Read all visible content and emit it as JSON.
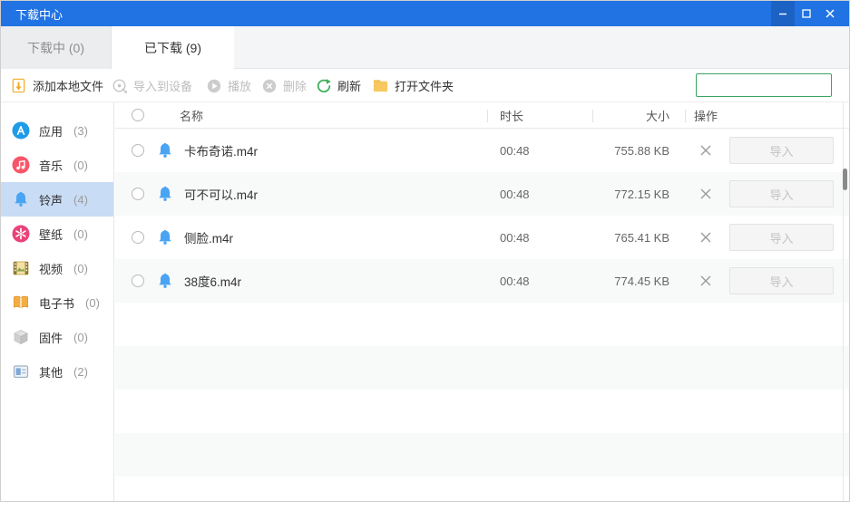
{
  "window": {
    "title": "下载中心"
  },
  "tabs": {
    "downloading": "下载中 (0)",
    "downloaded": "已下载 (9)"
  },
  "toolbar": {
    "add_local_file": "添加本地文件",
    "import_to_device": "导入到设备",
    "play": "播放",
    "delete": "删除",
    "refresh": "刷新",
    "open_folder": "打开文件夹",
    "search_value": ""
  },
  "sidebar": {
    "items": [
      {
        "label": "应用",
        "count": "(3)",
        "icon": "app-store-icon",
        "selected": false
      },
      {
        "label": "音乐",
        "count": "(0)",
        "icon": "music-icon",
        "selected": false
      },
      {
        "label": "铃声",
        "count": "(4)",
        "icon": "bell-icon",
        "selected": true
      },
      {
        "label": "壁纸",
        "count": "(0)",
        "icon": "wallpaper-icon",
        "selected": false
      },
      {
        "label": "视频",
        "count": "(0)",
        "icon": "video-icon",
        "selected": false
      },
      {
        "label": "电子书",
        "count": "(0)",
        "icon": "ebook-icon",
        "selected": false
      },
      {
        "label": "固件",
        "count": "(0)",
        "icon": "firmware-icon",
        "selected": false
      },
      {
        "label": "其他",
        "count": "(2)",
        "icon": "other-icon",
        "selected": false
      }
    ]
  },
  "table": {
    "headers": {
      "name": "名称",
      "duration": "时长",
      "size": "大小",
      "action": "操作"
    },
    "rows": [
      {
        "name": "卡布奇诺.m4r",
        "duration": "00:48",
        "size": "755.88 KB",
        "action": "导入"
      },
      {
        "name": "可不可以.m4r",
        "duration": "00:48",
        "size": "772.15 KB",
        "action": "导入"
      },
      {
        "name": "侧脸.m4r",
        "duration": "00:48",
        "size": "765.41 KB",
        "action": "导入"
      },
      {
        "name": "38度6.m4r",
        "duration": "00:48",
        "size": "774.45 KB",
        "action": "导入"
      }
    ]
  },
  "colors": {
    "titlebar_blue": "#2173e3",
    "selection_blue": "#c9dcf5",
    "bell_blue": "#49a4f3",
    "search_border_green": "#3aa562",
    "refresh_green": "#3fae5a",
    "folder_yellow": "#f6c85f"
  }
}
